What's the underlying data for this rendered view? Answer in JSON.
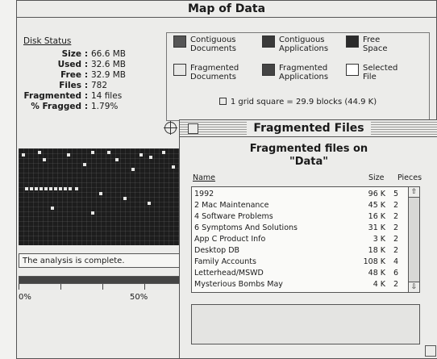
{
  "map_window": {
    "title": "Map of Data",
    "disk_status": {
      "heading": "Disk Status",
      "rows": [
        {
          "key": "Size",
          "value": "66.6 MB"
        },
        {
          "key": "Used",
          "value": "32.6 MB"
        },
        {
          "key": "Free",
          "value": "32.9 MB"
        },
        {
          "key": "Files",
          "value": "782"
        },
        {
          "key": "Fragmented",
          "value": "14 files"
        },
        {
          "key": "% Fragged",
          "value": "1.79%"
        }
      ]
    },
    "legend": {
      "items": [
        {
          "label": "Contiguous\nDocuments",
          "color": "#555555"
        },
        {
          "label": "Contiguous\nApplications",
          "color": "#3a3a3a"
        },
        {
          "label": "Free\nSpace",
          "color": "#2b2b2b"
        },
        {
          "label": "Fragmented\nDocuments",
          "color": "#e8e8e6"
        },
        {
          "label": "Fragmented\nApplications",
          "color": "#444444"
        },
        {
          "label": "Selected\nFile",
          "color": "#ffffff"
        }
      ],
      "grid_note": "1 grid square = 29.9 blocks (44.9 K)"
    },
    "status_message": "The analysis is complete.",
    "progress": {
      "fraction": 1.0,
      "labels": [
        "0%",
        "50%"
      ]
    }
  },
  "frag_window": {
    "title": "Fragmented Files",
    "heading_line1": "Fragmented files on",
    "heading_line2": "\"Data\"",
    "columns": {
      "name": "Name",
      "size": "Size",
      "pieces": "Pieces"
    },
    "files": [
      {
        "name": "1992",
        "size": "96 K",
        "pieces": "5"
      },
      {
        "name": "2 Mac Maintenance",
        "size": "45 K",
        "pieces": "2"
      },
      {
        "name": "4 Software Problems",
        "size": "16 K",
        "pieces": "2"
      },
      {
        "name": "6 Symptoms And Solutions",
        "size": "31 K",
        "pieces": "2"
      },
      {
        "name": "App C Product Info",
        "size": "3 K",
        "pieces": "2"
      },
      {
        "name": "Desktop DB",
        "size": "18 K",
        "pieces": "2"
      },
      {
        "name": "Family Accounts",
        "size": "108 K",
        "pieces": "4"
      },
      {
        "name": "Letterhead/MSWD",
        "size": "48 K",
        "pieces": "6"
      },
      {
        "name": "Mysterious Bombs May",
        "size": "4 K",
        "pieces": "2"
      }
    ]
  }
}
